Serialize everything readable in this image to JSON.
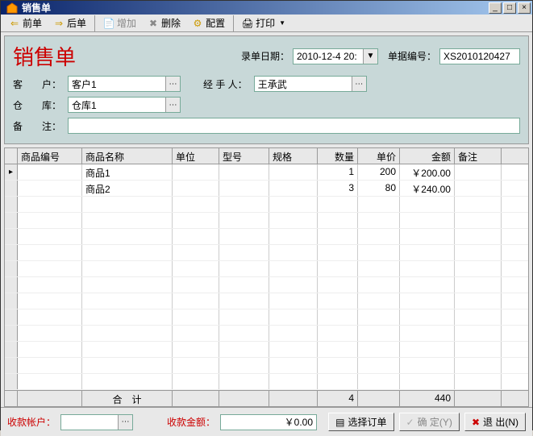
{
  "window": {
    "title": "销售单"
  },
  "toolbar": {
    "prev": "前单",
    "next": "后单",
    "add": "增加",
    "delete": "删除",
    "config": "配置",
    "print": "打印"
  },
  "form": {
    "title": "销售单",
    "date_label": "录单日期：",
    "date_value": "2010-12-4 20:",
    "docno_label": "单据编号：",
    "docno_value": "XS2010120427",
    "customer_label": "客　　户：",
    "customer_value": "客户1",
    "handler_label": "经 手 人：",
    "handler_value": "王承武",
    "warehouse_label": "仓　　库：",
    "warehouse_value": "仓库1",
    "remark_label": "备　　注："
  },
  "grid": {
    "headers": {
      "code": "商品编号",
      "name": "商品名称",
      "unit": "单位",
      "model": "型号",
      "spec": "规格",
      "qty": "数量",
      "price": "单价",
      "amt": "金额",
      "remark": "备注"
    },
    "rows": [
      {
        "code": "",
        "name": "商品1",
        "unit": "",
        "model": "",
        "spec": "",
        "qty": "1",
        "price": "200",
        "amt": "￥200.00",
        "remark": ""
      },
      {
        "code": "",
        "name": "商品2",
        "unit": "",
        "model": "",
        "spec": "",
        "qty": "3",
        "price": "80",
        "amt": "￥240.00",
        "remark": ""
      }
    ],
    "sum": {
      "label": "合　计",
      "qty": "4",
      "amt": "440"
    }
  },
  "footer": {
    "account_label": "收款帐户：",
    "amount_label": "收款金额：",
    "amount_value": "￥0.00",
    "select_order": "选择订单",
    "confirm": "确 定(Y)",
    "exit": "退 出(N)"
  }
}
